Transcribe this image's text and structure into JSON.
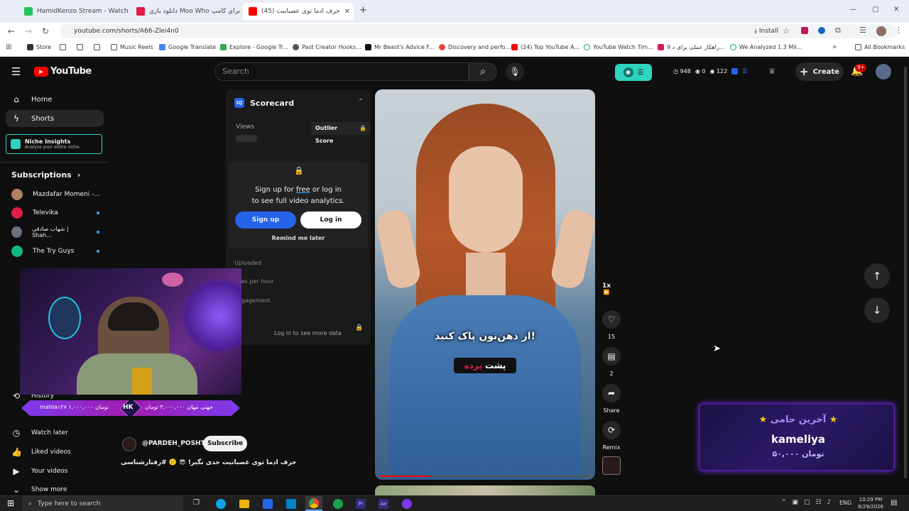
{
  "browser": {
    "tabs": [
      {
        "title": "HamidKenzo Stream - Watch L",
        "color": "#22c55e"
      },
      {
        "title": "دانلود بازی Moo Who برای کامپ",
        "color": "#e11d48"
      },
      {
        "title": "(45) حرف ادما توی عصبانیت",
        "color": "#ff0000"
      }
    ],
    "new_tab": "+",
    "window_controls": [
      "—",
      "▢",
      "✕"
    ],
    "url": "youtube.com/shorts/A66-Zlei4n0",
    "install_label": "Install",
    "bookmarks": [
      "Store",
      "",
      "",
      "Music Reels",
      "Google Translate",
      "Explore - Google Tr...",
      "Past Creator Hooks...",
      "Mr Beast's Advice F...",
      "Discovery and perfo...",
      "(24) Top YouTube A...",
      "YouTube Watch Tim...",
      "9 راهکار عملی برای د...",
      "We Analyzed 1.3 Mil..."
    ],
    "all_bookmarks": "All Bookmarks"
  },
  "youtube": {
    "logo_text": "YouTube",
    "search_placeholder": "Search",
    "stats": [
      "948",
      "0",
      "122"
    ],
    "create_label": "Create",
    "notif_badge": "9+"
  },
  "sidebar": {
    "items": [
      {
        "label": "Home",
        "icon": "home-icon"
      },
      {
        "label": "Shorts",
        "icon": "shorts-icon"
      }
    ],
    "niche": {
      "title": "Niche Insights",
      "subtitle": "Analyze your entire niche"
    },
    "subscriptions_label": "Subscriptions",
    "subs": [
      {
        "name": "Mazdafar Momeni -...",
        "color": "#b08060",
        "dot": false
      },
      {
        "name": "Televika",
        "color": "#e11d48",
        "dot": true
      },
      {
        "name": "شهاب صادقی | Shah...",
        "color": "#6b7280",
        "dot": true
      },
      {
        "name": "The Try Guys",
        "color": "#10b981",
        "dot": true
      }
    ],
    "history_label": "History",
    "watch_later_label": "Watch later",
    "liked_label": "Liked videos",
    "your_videos_label": "Your videos",
    "show_more_label": "Show more"
  },
  "scorecard": {
    "title": "Scorecard",
    "views_label": "Views",
    "outlier_label": "Outlier Score",
    "signup_text_1": "Sign up for",
    "signup_free": "free",
    "signup_text_2": "or log in",
    "signup_text_3": "to see full video analytics.",
    "signup_btn": "Sign up",
    "login_btn": "Log in",
    "remind": "Remind me later",
    "uploaded": "Uploaded",
    "views_per_hour": "ws per hour",
    "engagement": "gagement",
    "login_more": "Log in to see more data"
  },
  "stream_overlay": {
    "donation_1": "mahla۱۲۷ ۱,۰۰۰,۰۰۰ تومان",
    "donation_2": "جهنی مهان ۳,۰۰۰,۰۰۰ تومان",
    "hk": "HK"
  },
  "short": {
    "channel": "@PARDEH_POSHTI",
    "subscribe": "Subscribe",
    "caption": "حرف ادما توی عصبانیت جدی نگیر! 😎 🙂 #رفتارشناسی",
    "overlay_text": "از ذهن‌تون پاک کنید!",
    "brand_1": "پشت",
    "brand_2": "پرده",
    "speed": "1x",
    "likes": "15",
    "comments": "2",
    "share": "Share",
    "remix": "Remix"
  },
  "donation_box": {
    "title": "آخرین حامی",
    "name": "kameliya",
    "amount": "۵۰,۰۰۰ تومان"
  },
  "taskbar": {
    "search_placeholder": "Type here to search",
    "lang": "ENG",
    "time": "10:29 PM",
    "date": "8/29/2026"
  }
}
